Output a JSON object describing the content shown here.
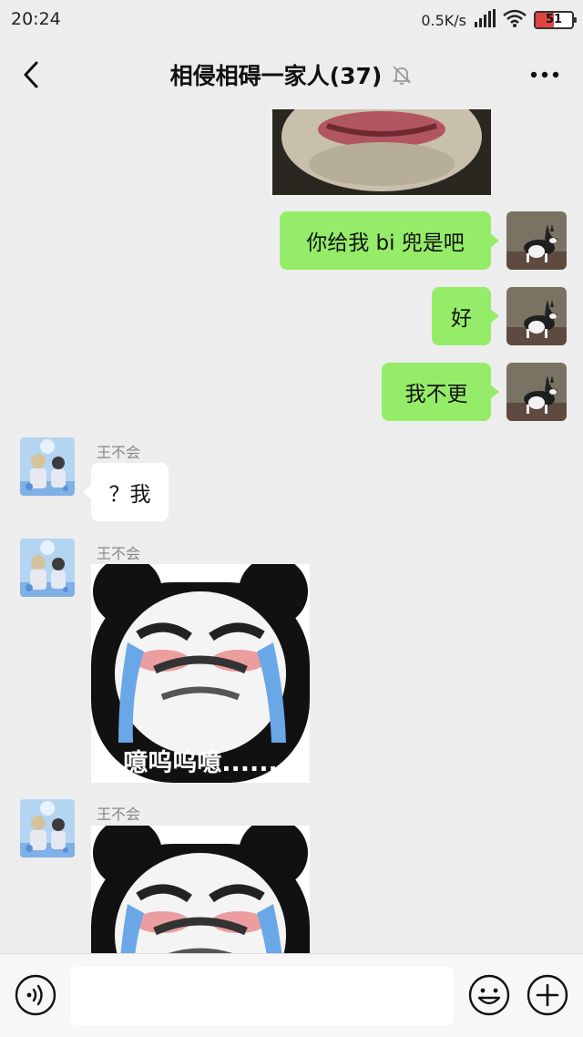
{
  "status_bar": {
    "time": "20:24",
    "net_speed": "0.5K/s",
    "battery": "51",
    "battery_level": 0.51,
    "battery_color": "#e0443e"
  },
  "nav": {
    "title": "相侵相碍一家人(37)"
  },
  "messages": {
    "m1": "你给我 bi 兜是吧",
    "m2": "好",
    "m3": "我不更",
    "m4_sender": "王不会",
    "m4": "？我",
    "m5_sender": "王不会",
    "m5_caption": "噫呜呜噫......",
    "m6_sender": "王不会"
  },
  "colors": {
    "outgoing_bubble": "#95ec69",
    "incoming_bubble": "#ffffff",
    "chat_background": "#ededed"
  },
  "icons": {
    "back": "chevron-left-icon",
    "mute": "bell-off-icon",
    "more": "more-dots-icon",
    "voice": "voice-icon",
    "emoji": "emoji-icon",
    "add": "plus-circle-icon"
  },
  "input": {
    "value": ""
  }
}
